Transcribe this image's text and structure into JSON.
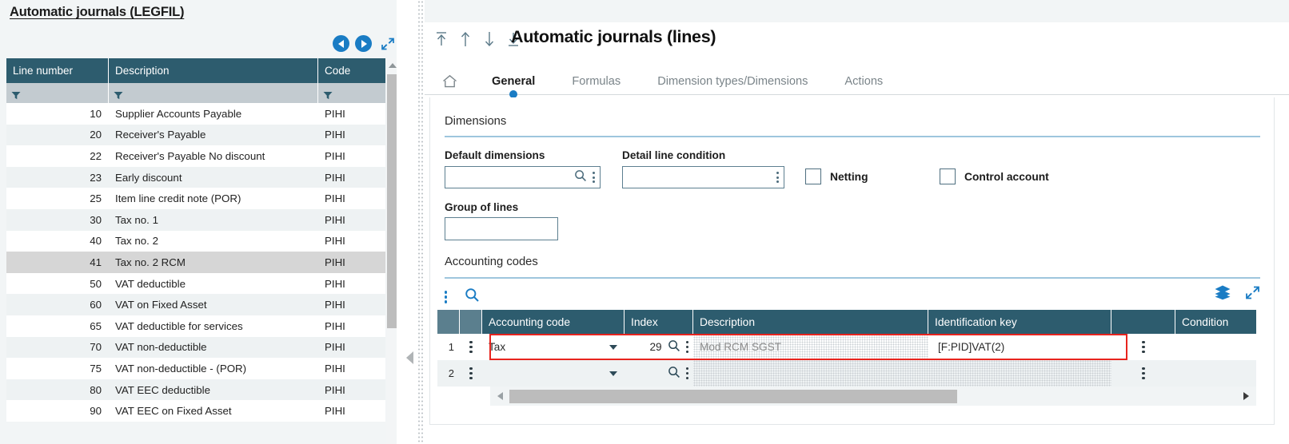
{
  "left_panel": {
    "title": "Automatic journals (LEGFIL)",
    "nav": {
      "prev_icon": "circle-left-arrow-icon",
      "next_icon": "circle-right-arrow-icon",
      "expand_icon": "expand-diagonal-icon"
    },
    "columns": [
      "Line number",
      "Description",
      "Code"
    ],
    "filter_icon": "funnel-filter-icon",
    "rows": [
      {
        "line": "10",
        "description": "Supplier Accounts Payable",
        "code": "PIHI"
      },
      {
        "line": "20",
        "description": "Receiver's Payable",
        "code": "PIHI"
      },
      {
        "line": "22",
        "description": "Receiver's Payable No discount",
        "code": "PIHI"
      },
      {
        "line": "23",
        "description": "Early discount",
        "code": "PIHI"
      },
      {
        "line": "25",
        "description": "Item line credit note (POR)",
        "code": "PIHI"
      },
      {
        "line": "30",
        "description": "Tax no. 1",
        "code": "PIHI"
      },
      {
        "line": "40",
        "description": "Tax no. 2",
        "code": "PIHI"
      },
      {
        "line": "41",
        "description": "Tax no. 2 RCM",
        "code": "PIHI"
      },
      {
        "line": "50",
        "description": "VAT deductible",
        "code": "PIHI"
      },
      {
        "line": "60",
        "description": "VAT on Fixed Asset",
        "code": "PIHI"
      },
      {
        "line": "65",
        "description": "VAT deductible for services",
        "code": "PIHI"
      },
      {
        "line": "70",
        "description": "VAT non-deductible",
        "code": "PIHI"
      },
      {
        "line": "75",
        "description": "VAT non-deductible - (POR)",
        "code": "PIHI"
      },
      {
        "line": "80",
        "description": "VAT EEC deductible",
        "code": "PIHI"
      },
      {
        "line": "90",
        "description": "VAT EEC on Fixed Asset",
        "code": "PIHI"
      }
    ],
    "selected_row_index": 7
  },
  "divider": {
    "collapse_icon": "collapse-left-triangle-icon"
  },
  "right_panel": {
    "record_nav": {
      "first_icon": "first-record-up-icon",
      "previous_icon": "previous-record-up-icon",
      "next_icon": "next-record-down-icon",
      "last_icon": "last-record-down-icon"
    },
    "title": "Automatic journals (lines)",
    "home_icon": "home-icon",
    "tabs": [
      {
        "label": "General",
        "active": true
      },
      {
        "label": "Formulas",
        "active": false
      },
      {
        "label": "Dimension types/Dimensions",
        "active": false
      },
      {
        "label": "Actions",
        "active": false
      }
    ],
    "sections": {
      "dimensions": {
        "title": "Dimensions",
        "fields": [
          {
            "label": "Default dimensions",
            "value": "",
            "lookup_icon": "search-icon",
            "menu_icon": "kebab-menu-icon"
          },
          {
            "label": "Detail line condition",
            "value": "",
            "menu_icon": "kebab-menu-icon"
          },
          {
            "label": "Group of lines",
            "value": ""
          }
        ],
        "checkboxes": [
          {
            "label": "Netting",
            "checked": false
          },
          {
            "label": "Control account",
            "checked": false
          }
        ]
      },
      "accounting_codes": {
        "title": "Accounting codes",
        "toolbar": {
          "menu_icon": "kebab-menu-icon",
          "search_icon": "search-icon",
          "layers_icon": "layers-stack-icon",
          "expand_icon": "expand-diagonal-icon"
        },
        "columns": [
          "Accounting code",
          "Index",
          "Description",
          "Identification key",
          "Condition"
        ],
        "rows": [
          {
            "num": "1",
            "accounting_code": "Tax",
            "index": "29",
            "description": "Mod RCM SGST",
            "identification_key": "[F:PID]VAT(2)",
            "condition": "",
            "highlighted": true
          },
          {
            "num": "2",
            "accounting_code": "",
            "index": "",
            "description": "",
            "identification_key": "",
            "condition": "",
            "highlighted": false
          }
        ],
        "highlight_color": "#e8241e"
      }
    }
  },
  "colors": {
    "header_teal": "#2d5c6e",
    "accent_blue": "#1a7cc4",
    "filter_gray": "#c3cbd0",
    "selection_gray": "#d6d6d6",
    "rule_blue": "#9ec6dd"
  }
}
